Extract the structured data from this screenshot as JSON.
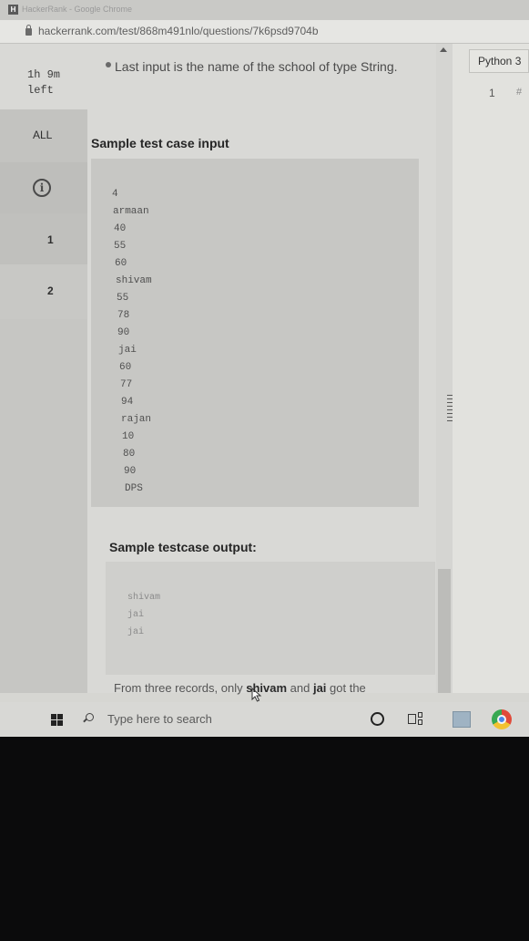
{
  "browser": {
    "tab_title": "HackerRank - Google Chrome",
    "app_icon_letter": "H",
    "url": "hackerrank.com/test/868m491nlo/questions/7k6psd9704b"
  },
  "sidebar": {
    "timer": "1h 9m\nleft",
    "all_label": "ALL",
    "info_glyph": "i",
    "questions": [
      "1",
      "2"
    ]
  },
  "problem": {
    "bullet_text": "Last input is the name of the school of type String.",
    "sample_input_heading": "Sample test case input",
    "sample_input_lines": [
      "4",
      "armaan",
      "40",
      "55",
      "60",
      "shivam",
      "55",
      "78",
      "90",
      "jai",
      "60",
      "77",
      "94",
      "rajan",
      "10",
      "80",
      "90",
      "DPS"
    ],
    "sample_output_heading": "Sample testcase output:",
    "sample_output_lines": [
      "shivam",
      "jai",
      "jai"
    ],
    "explanation_prefix": "From three records, only ",
    "explanation_name1": "shivam",
    "explanation_mid": " and ",
    "explanation_name2": "jai",
    "explanation_suffix": " got the"
  },
  "editor": {
    "language": "Python 3",
    "line_number": "1",
    "code_text": "#"
  },
  "taskbar": {
    "search_placeholder": "Type here to search"
  }
}
